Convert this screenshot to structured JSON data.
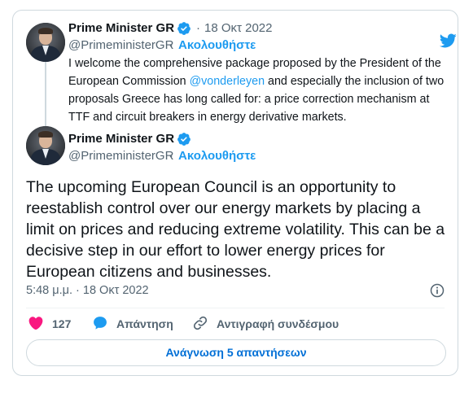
{
  "colors": {
    "accent": "#1d9bf0",
    "text": "#0f1419",
    "muted": "#536471",
    "like": "#f91880",
    "border": "#cfd9de"
  },
  "quoted_tweet": {
    "author_name": "Prime Minister GR",
    "separator": "·",
    "date": "18 Οκτ 2022",
    "handle": "@PrimeministerGR",
    "handle_sep": "·",
    "follow_label": "Ακολουθήστε",
    "text_before": "I welcome the comprehensive package proposed by the President of the European Commission ",
    "mention": "@vonderleyen",
    "text_after": " and especially the inclusion of two proposals Greece has long called for: a price correction mechanism at TTF and circuit breakers in energy derivative markets."
  },
  "main_tweet": {
    "author_name": "Prime Minister GR",
    "handle": "@PrimeministerGR",
    "handle_sep": "·",
    "follow_label": "Ακολουθήστε",
    "text": "The upcoming European Council is an opportunity to reestablish control over our energy markets by placing a limit on prices and reducing extreme volatility. This can be a decisive step in our effort to lower energy prices for European citizens and businesses.",
    "timestamp": "5:48 μ.μ. · 18 Οκτ 2022"
  },
  "actions": {
    "like_count": "127",
    "reply_label": "Απάντηση",
    "copy_link_label": "Αντιγραφή συνδέσμου"
  },
  "read_replies_label": "Ανάγνωση 5 απαντήσεων",
  "icons": [
    "twitter-bird-icon",
    "verified-badge-icon",
    "heart-icon",
    "reply-bubble-icon",
    "link-icon",
    "info-icon"
  ]
}
